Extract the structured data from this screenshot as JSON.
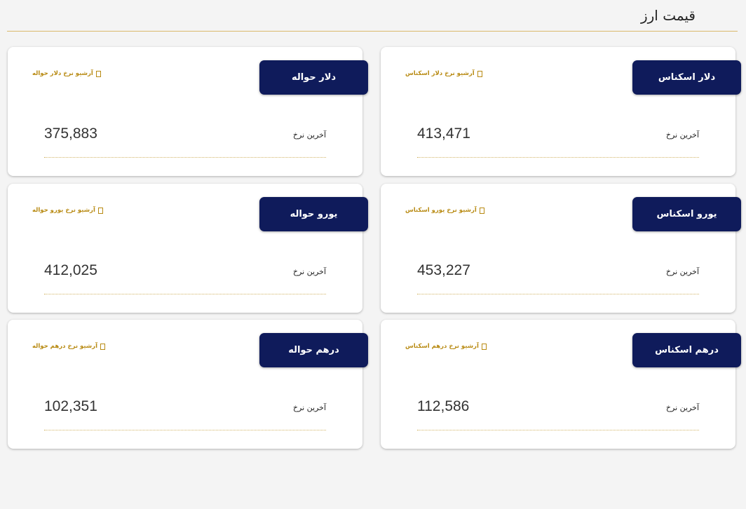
{
  "header": {
    "title": "قیمت ارز"
  },
  "cards": [
    {
      "name": "دلار اسکناس",
      "archive": "آرشیو نرخ دلار اسکناس",
      "last_rate_label": "آخرین نرخ",
      "value": "413,471"
    },
    {
      "name": "دلار حواله",
      "archive": "آرشیو نرخ دلار حواله",
      "last_rate_label": "آخرین نرخ",
      "value": "375,883"
    },
    {
      "name": "یورو اسکناس",
      "archive": "آرشیو نرخ یورو اسکناس",
      "last_rate_label": "آخرین نرخ",
      "value": "453,227"
    },
    {
      "name": "یورو حواله",
      "archive": "آرشیو نرخ یورو حواله",
      "last_rate_label": "آخرین نرخ",
      "value": "412,025"
    },
    {
      "name": "درهم اسکناس",
      "archive": "آرشیو نرخ درهم اسکناس",
      "last_rate_label": "آخرین نرخ",
      "value": "112,586"
    },
    {
      "name": "درهم حواله",
      "archive": "آرشیو نرخ درهم حواله",
      "last_rate_label": "آخرین نرخ",
      "value": "102,351"
    }
  ],
  "colors": {
    "pill_bg": "#0f1b5b",
    "accent_gold": "#b88a12",
    "divider": "#d9b86b",
    "page_bg": "#f4f4f4"
  },
  "icons": {
    "archive": "archive-box-icon"
  }
}
